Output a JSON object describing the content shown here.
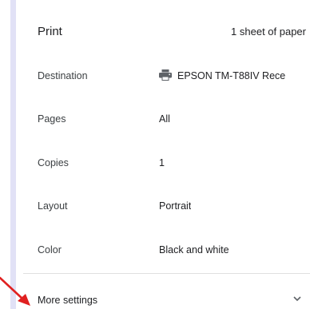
{
  "header": {
    "title": "Print",
    "sheet_count": "1 sheet of paper"
  },
  "settings": [
    {
      "label": "Destination",
      "value": "EPSON TM-T88IV Rece",
      "icon": "printer-icon",
      "dropdown": true
    },
    {
      "label": "Pages",
      "value": "All",
      "dropdown": true
    },
    {
      "label": "Copies",
      "value": "1",
      "dropdown": false
    },
    {
      "label": "Layout",
      "value": "Portrait",
      "dropdown": true
    },
    {
      "label": "Color",
      "value": "Black and white",
      "dropdown": true
    }
  ],
  "more_settings": {
    "label": "More settings",
    "icon": "chevron-down-icon"
  },
  "annotation": {
    "icon": "red-arrow-icon",
    "color": "#e02020"
  },
  "colors": {
    "side_strip": "#e1e1f6",
    "icon_gray": "#5f6368"
  }
}
